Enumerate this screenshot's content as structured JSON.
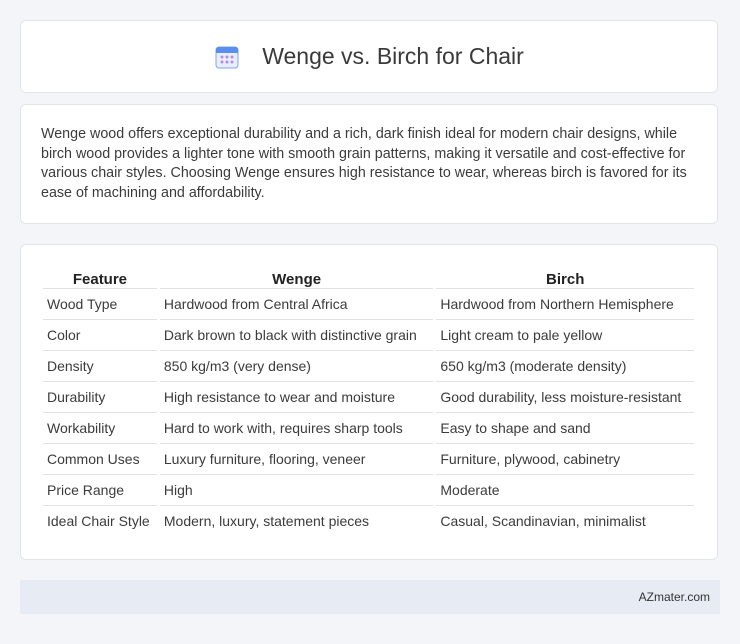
{
  "header": {
    "title": "Wenge vs. Birch for Chair",
    "icon": "calendar-icon"
  },
  "summary": {
    "text": "Wenge wood offers exceptional durability and a rich, dark finish ideal for modern chair designs, while birch wood provides a lighter tone with smooth grain patterns, making it versatile and cost-effective for various chair styles. Choosing Wenge ensures high resistance to wear, whereas birch is favored for its ease of machining and affordability."
  },
  "table": {
    "headers": [
      "Feature",
      "Wenge",
      "Birch"
    ],
    "rows": [
      [
        "Wood Type",
        "Hardwood from Central Africa",
        "Hardwood from Northern Hemisphere"
      ],
      [
        "Color",
        "Dark brown to black with distinctive grain",
        "Light cream to pale yellow"
      ],
      [
        "Density",
        "850 kg/m3 (very dense)",
        "650 kg/m3 (moderate density)"
      ],
      [
        "Durability",
        "High resistance to wear and moisture",
        "Good durability, less moisture-resistant"
      ],
      [
        "Workability",
        "Hard to work with, requires sharp tools",
        "Easy to shape and sand"
      ],
      [
        "Common Uses",
        "Luxury furniture, flooring, veneer",
        "Furniture, plywood, cabinetry"
      ],
      [
        "Price Range",
        "High",
        "Moderate"
      ],
      [
        "Ideal Chair Style",
        "Modern, luxury, statement pieces",
        "Casual, Scandinavian, minimalist"
      ]
    ]
  },
  "footer": {
    "text": "AZmater.com"
  },
  "colors": {
    "background": "#f3f5f9",
    "card": "#ffffff",
    "footer": "#e6ebf4",
    "icon_header": "#5b8def",
    "icon_body": "#e8eefc"
  }
}
